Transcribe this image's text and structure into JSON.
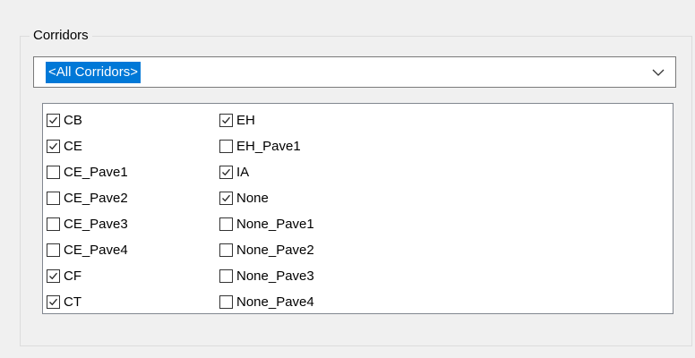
{
  "group": {
    "title": "Corridors"
  },
  "combo": {
    "value": "<All Corridors>",
    "icon": "chevron-down-icon"
  },
  "list": {
    "column1": [
      {
        "label": "CB",
        "checked": true
      },
      {
        "label": "CE",
        "checked": true
      },
      {
        "label": "CE_Pave1",
        "checked": false
      },
      {
        "label": "CE_Pave2",
        "checked": false
      },
      {
        "label": "CE_Pave3",
        "checked": false
      },
      {
        "label": "CE_Pave4",
        "checked": false
      },
      {
        "label": "CF",
        "checked": true
      },
      {
        "label": "CT",
        "checked": true
      }
    ],
    "column2": [
      {
        "label": "EH",
        "checked": true
      },
      {
        "label": "EH_Pave1",
        "checked": false
      },
      {
        "label": "IA",
        "checked": true
      },
      {
        "label": "None",
        "checked": true
      },
      {
        "label": "None_Pave1",
        "checked": false
      },
      {
        "label": "None_Pave2",
        "checked": false
      },
      {
        "label": "None_Pave3",
        "checked": false
      },
      {
        "label": "None_Pave4",
        "checked": false
      }
    ]
  }
}
